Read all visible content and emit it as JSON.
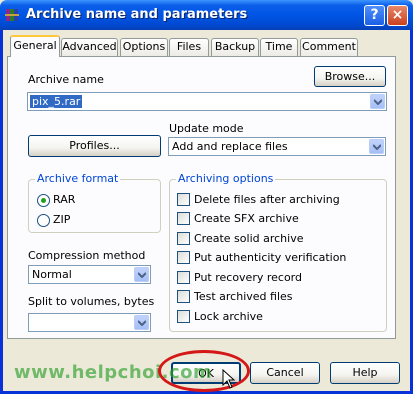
{
  "window": {
    "title": "Archive name and parameters",
    "help_glyph": "?",
    "close_glyph": "×"
  },
  "tabs": [
    "General",
    "Advanced",
    "Options",
    "Files",
    "Backup",
    "Time",
    "Comment"
  ],
  "active_tab": "General",
  "general": {
    "archive_name_label": "Archive name",
    "browse_label": "Browse...",
    "archive_name_value": "pix_5.rar",
    "profiles_label": "Profiles...",
    "update_mode_label": "Update mode",
    "update_mode_value": "Add and replace files",
    "archive_format": {
      "title": "Archive format",
      "options": [
        "RAR",
        "ZIP"
      ],
      "selected": "RAR"
    },
    "compression_label": "Compression method",
    "compression_value": "Normal",
    "split_label": "Split to volumes, bytes",
    "split_value": "",
    "archiving_options": {
      "title": "Archiving options",
      "items": [
        "Delete files after archiving",
        "Create SFX archive",
        "Create solid archive",
        "Put authenticity verification",
        "Put recovery record",
        "Test archived files",
        "Lock archive"
      ],
      "checked": [
        false,
        false,
        false,
        false,
        false,
        false,
        false
      ]
    }
  },
  "buttons": {
    "ok": "OK",
    "cancel": "Cancel",
    "help": "Help"
  },
  "watermark": "www.helpchoi.com",
  "icons": {
    "app": "winrar-books-icon",
    "dropdown": "chevron-down-icon",
    "cursor": "mouse-pointer-icon"
  },
  "colors": {
    "title_bar": "#0055e5",
    "group_title": "#0046d5",
    "selection": "#316ac5",
    "highlight_ellipse": "#d41818",
    "watermark": "#2ea02e"
  }
}
